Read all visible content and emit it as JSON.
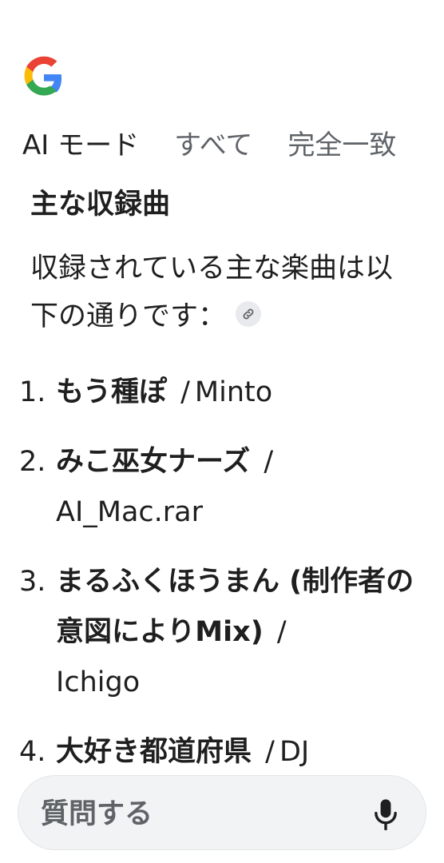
{
  "tabs": [
    {
      "label": "AI モード",
      "active": true
    },
    {
      "label": "すべて",
      "active": false
    },
    {
      "label": "完全一致",
      "active": false
    }
  ],
  "answer": {
    "heading": "主な収録曲",
    "intro": "収録されている主な楽曲は以下の通りです："
  },
  "tracks": [
    {
      "num": "1.",
      "title": "もう種ぽ",
      "sep": "/",
      "artist": "Minto"
    },
    {
      "num": "2.",
      "title": "みこ巫女ナーズ",
      "sep": "/",
      "artist": "AI_Mac.rar"
    },
    {
      "num": "3.",
      "title": "まるふくほうまん (制作者の意図によりMix)",
      "sep": "/",
      "artist": "Ichigo"
    },
    {
      "num": "4.",
      "title": "大好き都道府県",
      "sep": "/",
      "artist": "DJ"
    }
  ],
  "ask_bar": {
    "placeholder": "質問する"
  },
  "icons": {
    "logo": "google-g-logo",
    "link": "link-icon",
    "mic": "microphone-icon"
  },
  "colors": {
    "text": "#1f1f1f",
    "muted": "#5f6368",
    "ask_bar_bg": "#f1f3f4"
  }
}
